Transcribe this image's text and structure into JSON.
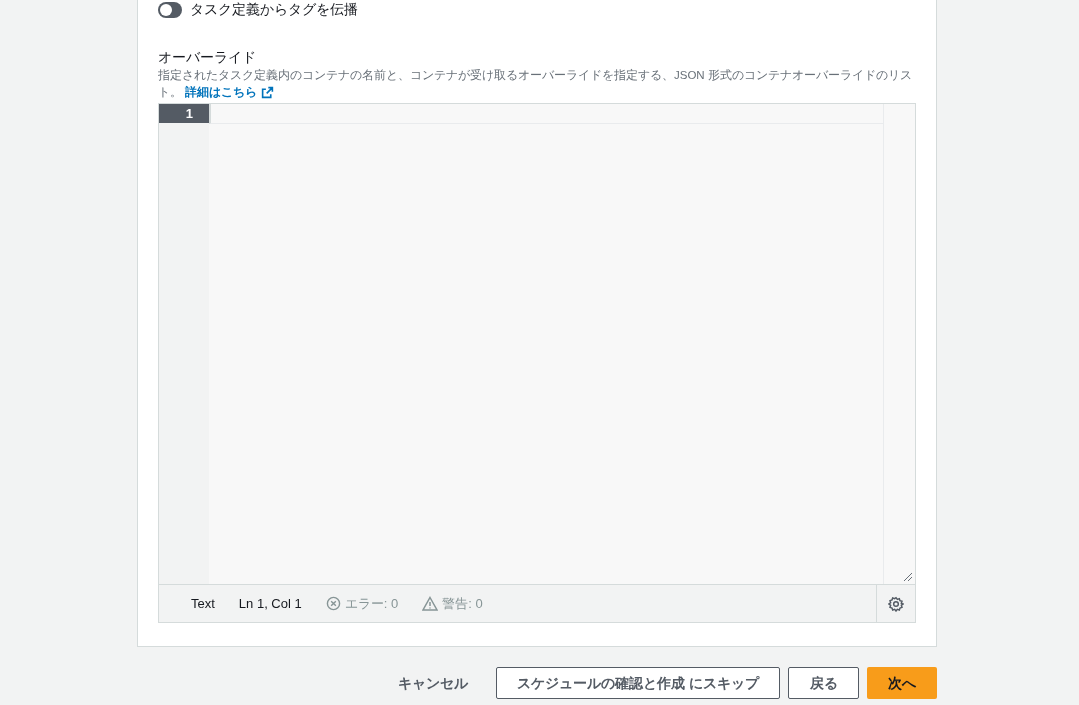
{
  "propagate_tags": {
    "label": "タスク定義からタグを伝播",
    "on": false
  },
  "overrides": {
    "label": "オーバーライド",
    "description": "指定されたタスク定義内のコンテナの名前と、コンテナが受け取るオーバーライドを指定する、JSON 形式のコンテナオーバーライドのリスト。",
    "link": "詳細はこちら",
    "editor": {
      "line_numbers": [
        "1"
      ],
      "status": {
        "mode": "Text",
        "position": "Ln 1, Col 1",
        "errors": "エラー: 0",
        "warnings": "警告: 0"
      }
    }
  },
  "footer": {
    "cancel": "キャンセル",
    "skip": "スケジュールの確認と作成 にスキップ",
    "back": "戻る",
    "next": "次へ"
  }
}
